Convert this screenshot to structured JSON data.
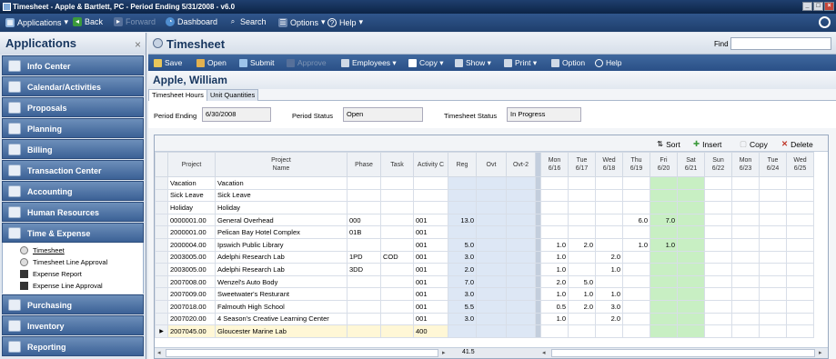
{
  "window": {
    "title": "Timesheet - Apple & Bartlett, PC - Period Ending 5/31/2008 - v6.0",
    "controls": [
      "_",
      "□",
      "×"
    ]
  },
  "menubar": {
    "items": [
      {
        "label": "Applications",
        "icon": "applications-icon",
        "dim": false
      },
      {
        "label": "Back",
        "icon": "back-arrow-icon",
        "dim": false
      },
      {
        "label": "Forward",
        "icon": "forward-arrow-icon",
        "dim": true
      },
      {
        "label": "Dashboard",
        "icon": "dashboard-icon",
        "dim": false
      },
      {
        "label": "Search",
        "icon": "search-icon",
        "dim": false
      },
      {
        "label": "Options",
        "icon": "options-icon",
        "dim": false
      },
      {
        "label": "Help",
        "icon": "help-icon",
        "dim": false
      }
    ]
  },
  "sidebar": {
    "title": "Applications",
    "close": "×",
    "items": [
      {
        "label": "Info Center",
        "icon": "info-center-icon"
      },
      {
        "label": "Calendar/Activities",
        "icon": "calendar-icon"
      },
      {
        "label": "Proposals",
        "icon": "proposals-icon"
      },
      {
        "label": "Planning",
        "icon": "planning-icon"
      },
      {
        "label": "Billing",
        "icon": "billing-icon"
      },
      {
        "label": "Transaction Center",
        "icon": "transaction-center-icon"
      },
      {
        "label": "Accounting",
        "icon": "accounting-icon"
      },
      {
        "label": "Human Resources",
        "icon": "human-resources-icon"
      },
      {
        "label": "Time & Expense",
        "icon": "time-expense-icon"
      }
    ],
    "subitems": [
      {
        "label": "Timesheet",
        "link": true,
        "icon": "radio"
      },
      {
        "label": "Timesheet Line Approval",
        "link": false,
        "icon": "radio"
      },
      {
        "label": "Expense Report",
        "link": false,
        "icon": "doc"
      },
      {
        "label": "Expense Line Approval",
        "link": false,
        "icon": "doc"
      }
    ],
    "items_after": [
      {
        "label": "Purchasing",
        "icon": "purchasing-icon"
      },
      {
        "label": "Inventory",
        "icon": "inventory-icon"
      },
      {
        "label": "Reporting",
        "icon": "reporting-icon"
      }
    ]
  },
  "header": {
    "title": "Timesheet",
    "find_label": "Find"
  },
  "toolbar": {
    "items": [
      {
        "label": "Save",
        "dim": false
      },
      {
        "label": "Open",
        "dim": false
      },
      {
        "label": "Submit",
        "dim": false
      },
      {
        "label": "Approve",
        "dim": true
      },
      {
        "label": "Employees ▾",
        "dim": false
      },
      {
        "label": "Copy ▾",
        "dim": false
      },
      {
        "label": "Show ▾",
        "dim": false
      },
      {
        "label": "Print ▾",
        "dim": false
      },
      {
        "label": "Option",
        "dim": false
      },
      {
        "label": "Help",
        "dim": false
      }
    ]
  },
  "employee": "Apple, William",
  "tabs": [
    "Timesheet Hours",
    "Unit Quantities"
  ],
  "fields": {
    "period_ending_label": "Period Ending",
    "period_ending": "6/30/2008",
    "period_status_label": "Period Status",
    "period_status": "Open",
    "timesheet_status_label": "Timesheet Status",
    "timesheet_status": "In Progress"
  },
  "grid_toolbar": {
    "sort": "Sort",
    "insert": "Insert",
    "copy": "Copy",
    "delete": "Delete"
  },
  "grid": {
    "columns": [
      "Project",
      "Project\nName",
      "Phase",
      "Task",
      "Activity C",
      "Reg",
      "Ovt",
      "Ovt-2",
      "Mon\n6/16",
      "Tue\n6/17",
      "Wed\n6/18",
      "Thu\n6/19",
      "Fri\n6/20",
      "Sat\n6/21",
      "Sun\n6/22",
      "Mon\n6/23",
      "Tue\n6/24",
      "Wed\n6/25"
    ],
    "rows": [
      [
        "Vacation",
        "Vacation",
        "",
        "",
        "",
        "",
        "",
        "",
        "",
        "",
        "",
        "",
        "",
        "",
        "",
        "",
        "",
        ""
      ],
      [
        "Sick Leave",
        "Sick Leave",
        "",
        "",
        "",
        "",
        "",
        "",
        "",
        "",
        "",
        "",
        "",
        "",
        "",
        "",
        "",
        ""
      ],
      [
        "Holiday",
        "Holiday",
        "",
        "",
        "",
        "",
        "",
        "",
        "",
        "",
        "",
        "",
        "",
        "",
        "",
        "",
        "",
        ""
      ],
      [
        "0000001.00",
        "General Overhead",
        "000",
        "",
        "001",
        "13.0",
        "",
        "",
        "",
        "",
        "",
        "6.0",
        "7.0",
        "",
        "",
        "",
        "",
        ""
      ],
      [
        "2000001.00",
        "Pelican Bay Hotel Complex",
        "01B",
        "",
        "001",
        "",
        "",
        "",
        "",
        "",
        "",
        "",
        "",
        "",
        "",
        "",
        "",
        ""
      ],
      [
        "2000004.00",
        "Ipswich Public Library",
        "",
        "",
        "001",
        "5.0",
        "",
        "",
        "1.0",
        "2.0",
        "",
        "1.0",
        "1.0",
        "",
        "",
        "",
        "",
        ""
      ],
      [
        "2003005.00",
        "Adelphi Research Lab",
        "1PD",
        "COD",
        "001",
        "3.0",
        "",
        "",
        "1.0",
        "",
        "2.0",
        "",
        "",
        "",
        "",
        "",
        "",
        ""
      ],
      [
        "2003005.00",
        "Adelphi Research Lab",
        "3DD",
        "",
        "001",
        "2.0",
        "",
        "",
        "1.0",
        "",
        "1.0",
        "",
        "",
        "",
        "",
        "",
        "",
        ""
      ],
      [
        "2007008.00",
        "Wenzel's Auto Body",
        "",
        "",
        "001",
        "7.0",
        "",
        "",
        "2.0",
        "5.0",
        "",
        "",
        "",
        "",
        "",
        "",
        "",
        ""
      ],
      [
        "2007009.00",
        "Sweetwater's Resturant",
        "",
        "",
        "001",
        "3.0",
        "",
        "",
        "1.0",
        "1.0",
        "1.0",
        "",
        "",
        "",
        "",
        "",
        "",
        ""
      ],
      [
        "2007018.00",
        "Falmouth High School",
        "",
        "",
        "001",
        "5.5",
        "",
        "",
        "0.5",
        "2.0",
        "3.0",
        "",
        "",
        "",
        "",
        "",
        "",
        ""
      ],
      [
        "2007020.00",
        "4 Season's Creative Learning Center",
        "",
        "",
        "001",
        "3.0",
        "",
        "",
        "1.0",
        "",
        "2.0",
        "",
        "",
        "",
        "",
        "",
        "",
        ""
      ],
      [
        "2007045.00",
        "Gloucester Marine Lab",
        "",
        "",
        "400",
        "",
        "",
        "",
        "",
        "",
        "",
        "",
        "",
        "",
        "",
        "",
        "",
        ""
      ]
    ],
    "total_reg": "41.5"
  }
}
